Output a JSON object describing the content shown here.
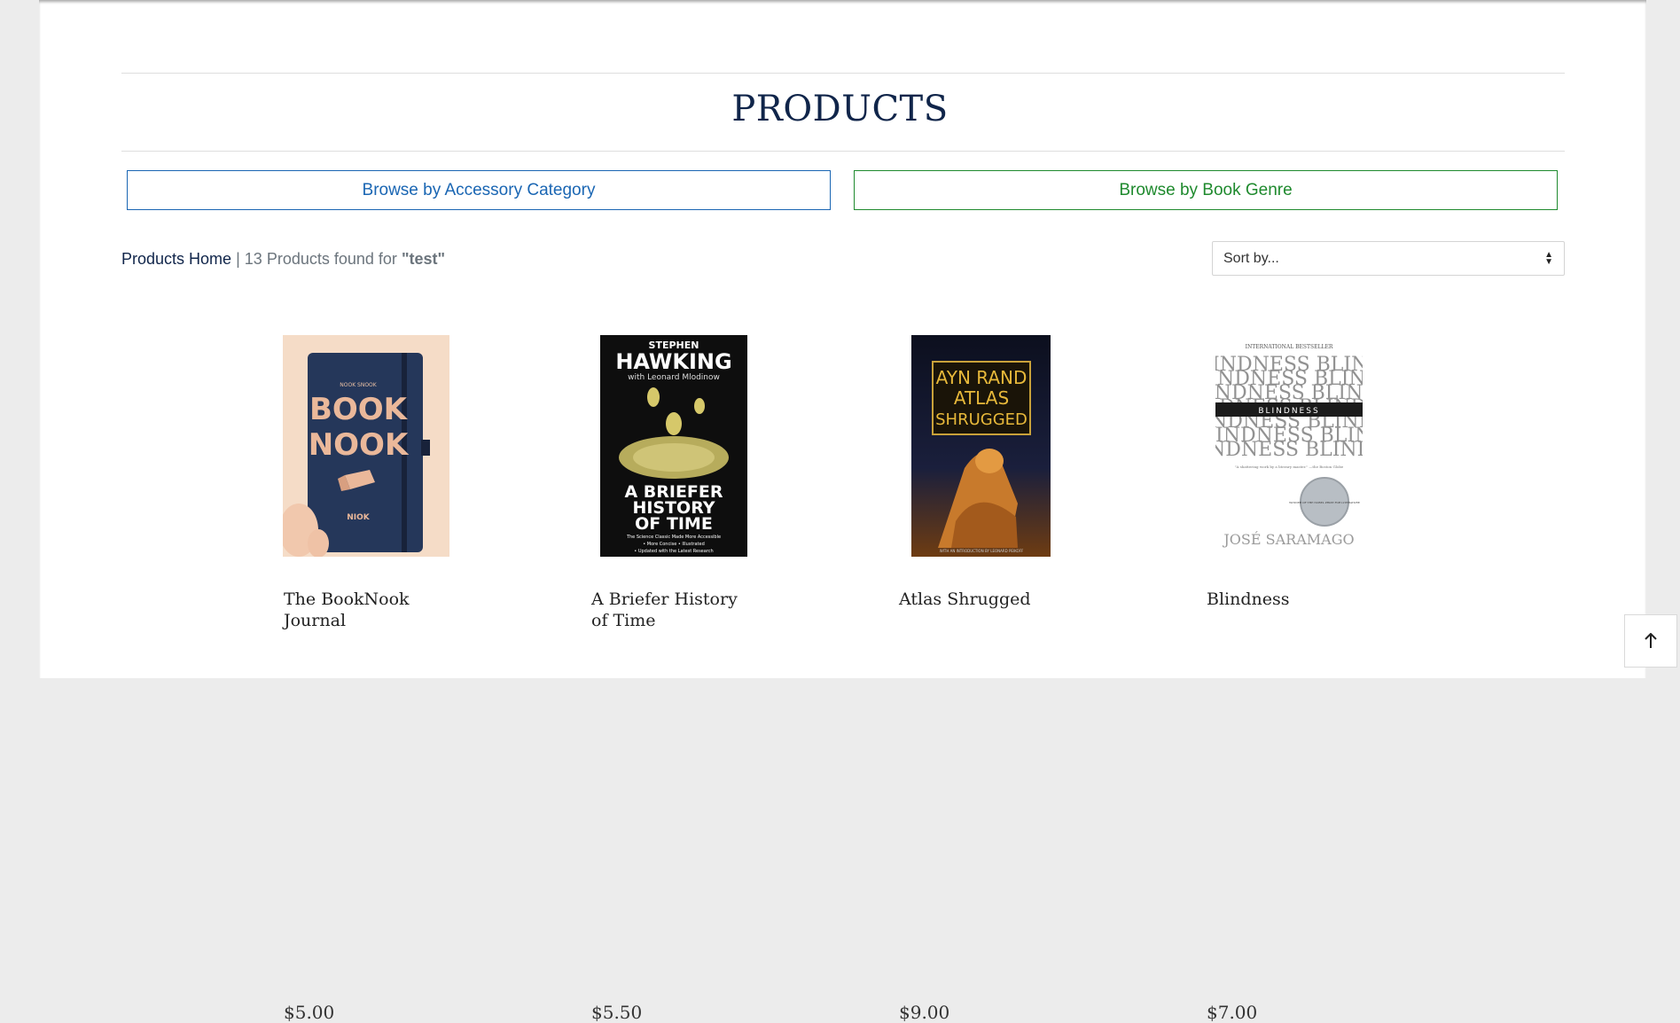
{
  "page": {
    "title": "PRODUCTS",
    "browse_accessory_label": "Browse by Accessory Category",
    "browse_genre_label": "Browse by Book Genre",
    "breadcrumb_home": "Products Home",
    "separator": "|",
    "results_count": "13",
    "results_text": "Products found for",
    "query": "\"test\"",
    "sort_label": "Sort by..."
  },
  "colors": {
    "accent_blue": "#1a66b3",
    "accent_green": "#1f8a2e",
    "heading_navy": "#10254a"
  },
  "products": [
    {
      "name": "The BookNook Journal",
      "price": "$5.00",
      "cover_text": [
        "BOOK",
        "NOOK",
        "NIOK"
      ]
    },
    {
      "name": "A Briefer History of Time",
      "price": "$5.50",
      "cover_text": [
        "STEPHEN",
        "HAWKING",
        "with Leonard Mlodinow",
        "A BRIEFER",
        "HISTORY",
        "OF TIME",
        "The Science Classic Made More Accessible",
        "• More Concise • Illustrated",
        "• Updated with the Latest Research"
      ]
    },
    {
      "name": "Atlas Shrugged",
      "price": "$9.00",
      "cover_text": [
        "AYN RAND",
        "ATLAS",
        "SHRUGGED",
        "WITH AN INTRODUCTION BY LEONARD PEIKOFF"
      ]
    },
    {
      "name": "Blindness",
      "price": "$7.00",
      "cover_text": [
        "INTERNATIONAL BESTSELLER",
        "BLINDNESS",
        "\"A shattering work by a literary master.\" —the Boston Globe",
        "WINNER OF THE NOBEL PRIZE FOR LITERATURE",
        "JOSÉ SARAMAGO"
      ]
    }
  ],
  "icons": {
    "scroll_top": "arrow-up-icon",
    "sort": "sort-arrows-icon"
  }
}
